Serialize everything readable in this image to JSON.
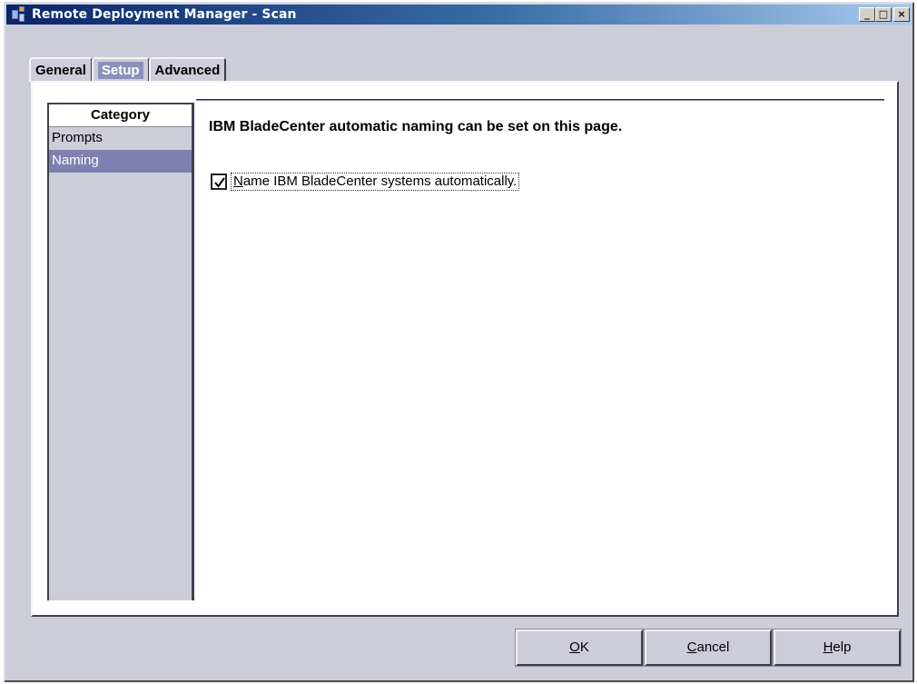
{
  "window": {
    "title": "Remote Deployment Manager - Scan",
    "controls": {
      "minimize": "_",
      "maximize": "□",
      "close": "×"
    }
  },
  "tabs": [
    {
      "label": "General",
      "active": false
    },
    {
      "label": "Setup",
      "active": true
    },
    {
      "label": "Advanced",
      "active": false
    }
  ],
  "category": {
    "header": "Category",
    "items": [
      {
        "label": "Prompts",
        "selected": false
      },
      {
        "label": "Naming",
        "selected": true
      }
    ]
  },
  "content": {
    "heading": "IBM BladeCenter automatic naming can be set on this page.",
    "checkbox": {
      "label_mnemonic": "N",
      "label_rest": "ame IBM BladeCenter systems automatically.",
      "checked": true
    }
  },
  "buttons": {
    "ok": {
      "mnemonic": "O",
      "rest": "K"
    },
    "cancel": {
      "mnemonic": "C",
      "rest": "ancel"
    },
    "help": {
      "mnemonic": "H",
      "rest": "elp"
    }
  },
  "colors": {
    "title_gradient_start": "#0a246a",
    "selection": "#8080b0",
    "panel_bg": "#cdcdd9"
  }
}
